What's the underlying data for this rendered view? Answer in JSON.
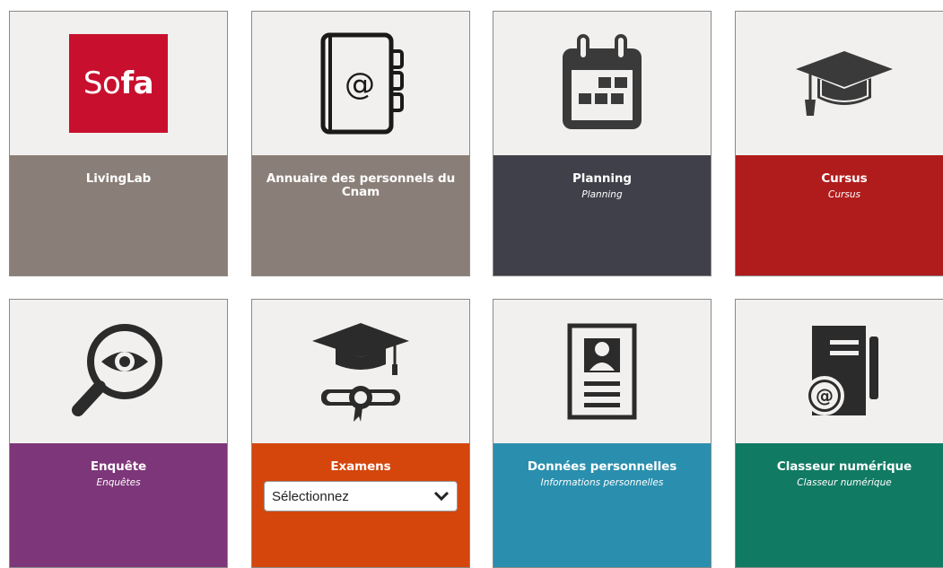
{
  "tiles": [
    {
      "title": "LivingLab",
      "subtitle": "",
      "icon": "sofa-logo",
      "color": "#8a7f78",
      "logo_text_regular": "So",
      "logo_text_bold": "fa",
      "logo_color": "#c8102e"
    },
    {
      "title": "Annuaire des personnels du Cnam",
      "subtitle": "",
      "icon": "address-book-icon",
      "color": "#8a7f78"
    },
    {
      "title": "Planning",
      "subtitle": "Planning",
      "icon": "calendar-icon",
      "color": "#40404a"
    },
    {
      "title": "Cursus",
      "subtitle": "Cursus",
      "icon": "graduation-cap-icon",
      "color": "#b01c1c"
    },
    {
      "title": "Enquête",
      "subtitle": "Enquêtes",
      "icon": "magnifier-eye-icon",
      "color": "#7d3679"
    },
    {
      "title": "Examens",
      "subtitle": "",
      "icon": "graduation-diploma-icon",
      "color": "#d4460c",
      "select_value": "Sélectionnez"
    },
    {
      "title": "Données personnelles",
      "subtitle": "Informations personnelles",
      "icon": "id-document-icon",
      "color": "#2a8fae"
    },
    {
      "title": "Classeur numérique",
      "subtitle": "Classeur numérique",
      "icon": "folder-at-icon",
      "color": "#117a63"
    }
  ]
}
